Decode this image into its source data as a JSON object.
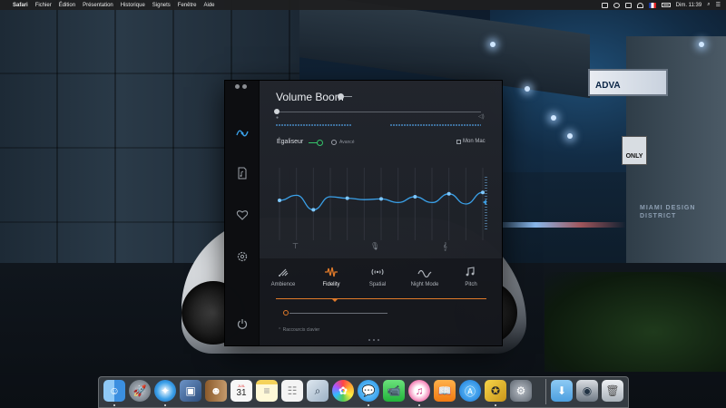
{
  "menubar": {
    "apple": "",
    "app_name": "Safari",
    "menus": [
      "Fichier",
      "Édition",
      "Présentation",
      "Historique",
      "Signets",
      "Fenêtre",
      "Aide"
    ],
    "clock": "Dim. 11:39"
  },
  "app": {
    "title": "Volume Boom",
    "equalizer": {
      "label": "Égaliseur",
      "advanced_label": "Avancé",
      "device_label": "Mon Mac",
      "band_levels": [
        0.55,
        0.62,
        0.42,
        0.6,
        0.58,
        0.56,
        0.57,
        0.52,
        0.6,
        0.52,
        0.64,
        0.5,
        0.66
      ],
      "accent_color": "#3aa0e8"
    },
    "modes": [
      {
        "label": "Ambience",
        "icon": "ambience-icon",
        "active": false
      },
      {
        "label": "Fidelity",
        "icon": "fidelity-icon",
        "active": true
      },
      {
        "label": "Spatial",
        "icon": "spatial-icon",
        "active": false
      },
      {
        "label": "Night Mode",
        "icon": "night-mode-icon",
        "active": false
      },
      {
        "label": "Pitch",
        "icon": "pitch-icon",
        "active": false
      }
    ],
    "intensity_level": 0.0,
    "shortcuts_label": "Raccourcis clavier",
    "accent_color": "#e07a2a",
    "toggle_color": "#35c46a"
  },
  "wallpaper": {
    "billboard_text": "ADVA",
    "sign_text": "ONLY",
    "building_text": "MIAMI DESIGN DISTRICT"
  },
  "dock": {
    "apps": [
      "Finder",
      "Launchpad",
      "Safari",
      "Mail Preview",
      "Contacts",
      "Calendar",
      "Notes",
      "Reminders",
      "Preview",
      "Photos",
      "Messages",
      "FaceTime",
      "iTunes",
      "iBooks",
      "App Store",
      "Volume Boom",
      "System Preferences"
    ],
    "calendar_day": "31",
    "calendar_month": "JUIL"
  }
}
